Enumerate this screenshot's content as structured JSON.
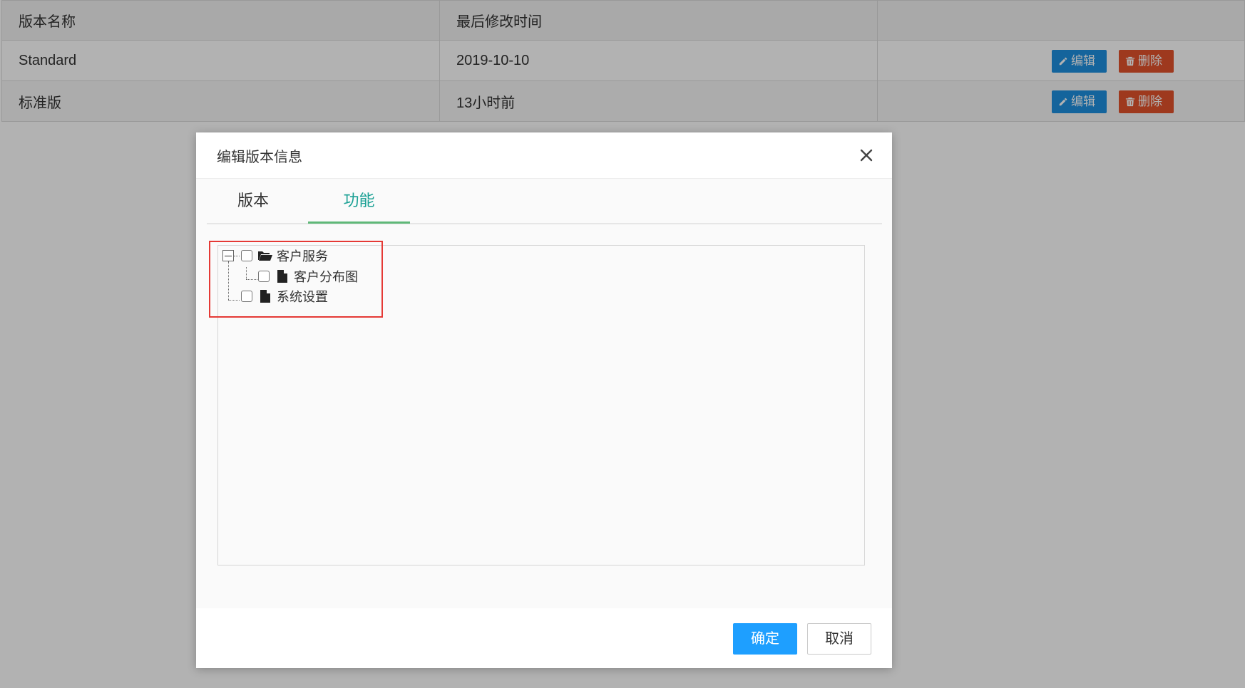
{
  "table": {
    "headers": [
      "版本名称",
      "最后修改时间",
      ""
    ],
    "rows": [
      {
        "name": "Standard",
        "modified": "2019-10-10",
        "edit_label": "编辑",
        "delete_label": "删除"
      },
      {
        "name": "标准版",
        "modified": "13小时前",
        "edit_label": "编辑",
        "delete_label": "删除"
      }
    ]
  },
  "modal": {
    "title": "编辑版本信息",
    "close_icon": "close-icon",
    "tabs": [
      {
        "label": "版本",
        "active": false
      },
      {
        "label": "功能",
        "active": true
      }
    ],
    "tree": [
      {
        "label": "客户服务",
        "icon": "folder-open-icon",
        "expanded": true,
        "checked": false,
        "children": [
          {
            "label": "客户分布图",
            "icon": "file-icon",
            "checked": false
          }
        ]
      },
      {
        "label": "系统设置",
        "icon": "file-icon",
        "checked": false
      }
    ],
    "ok_label": "确定",
    "cancel_label": "取消"
  },
  "colors": {
    "accent": "#1e9fff",
    "edit_button": "#1e90e0",
    "delete_button": "#e2522c",
    "active_tab": "#1aa094",
    "tab_underline": "#5fb878",
    "highlight_box": "#e53935"
  }
}
